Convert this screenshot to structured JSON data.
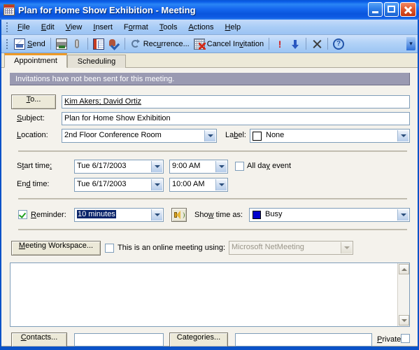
{
  "window": {
    "title": "Plan for Home Show Exhibition - Meeting",
    "icon": "calendar-icon",
    "minimize_label": "Minimize",
    "maximize_label": "Maximize",
    "close_label": "Close"
  },
  "menu": {
    "items": [
      {
        "label": "File",
        "accel": "F"
      },
      {
        "label": "Edit",
        "accel": "E"
      },
      {
        "label": "View",
        "accel": "V"
      },
      {
        "label": "Insert",
        "accel": "I"
      },
      {
        "label": "Format",
        "accel": "o"
      },
      {
        "label": "Tools",
        "accel": "T"
      },
      {
        "label": "Actions",
        "accel": "A"
      },
      {
        "label": "Help",
        "accel": "H"
      }
    ]
  },
  "toolbar": {
    "send_label": "Send",
    "print_label": "Print",
    "attach_label": "Insert File",
    "addressbook_label": "Address Book",
    "checknames_label": "Check Names",
    "recurrence_label": "Recurrence...",
    "cancel_invitation_label": "Cancel Invitation",
    "importance_high_label": "High Importance",
    "importance_low_label": "Low Importance",
    "delete_label": "Delete",
    "help_label": "Microsoft Outlook Help",
    "overflow_label": "Toolbar Options"
  },
  "tabs": [
    {
      "label": "Appointment",
      "active": true
    },
    {
      "label": "Scheduling",
      "active": false
    }
  ],
  "form": {
    "infobar_text": "Invitations have not been sent for this meeting.",
    "to_button_label": "To...",
    "to_value": "Kim Akers; David Ortiz",
    "subject_label": "Subject:",
    "subject_value": "Plan for Home Show Exhibition",
    "location_label": "Location:",
    "location_value": "2nd Floor Conference Room",
    "label_label": "Label:",
    "label_value": "None",
    "start_time_label": "Start time:",
    "start_date_value": "Tue 6/17/2003",
    "start_clock_value": "9:00 AM",
    "end_time_label": "End time:",
    "end_date_value": "Tue 6/17/2003",
    "end_clock_value": "10:00 AM",
    "all_day_label": "All day event",
    "all_day_checked": false,
    "reminder_label": "Reminder:",
    "reminder_checked": true,
    "reminder_value": "10 minutes",
    "reminder_sound_label": "Reminder Sound",
    "show_time_as_label": "Show time as:",
    "show_time_as_value": "Busy",
    "show_time_as_color": "#0000cc",
    "meeting_workspace_label": "Meeting Workspace...",
    "online_meeting_label": "This is an online meeting using:",
    "online_meeting_checked": false,
    "online_provider_value": "Microsoft NetMeeting",
    "notes_value": ""
  },
  "footer": {
    "contacts_button_label": "Contacts...",
    "contacts_value": "",
    "categories_button_label": "Categories...",
    "categories_value": "",
    "private_label": "Private",
    "private_checked": false
  },
  "colors": {
    "titlebar_blue": "#0a52c8",
    "tab_accent_orange": "#ee9a27",
    "infobar_gray": "#9a9ab2",
    "form_bg": "#f4f2ec",
    "selection_blue": "#0a246a"
  }
}
